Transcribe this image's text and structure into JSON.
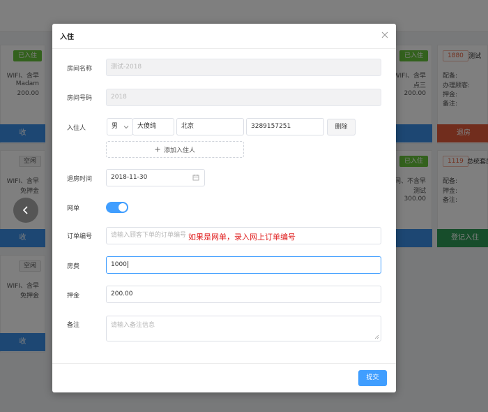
{
  "dialog": {
    "title": "入住",
    "room_name": {
      "label": "房间名称",
      "value": "测试-2018"
    },
    "room_no": {
      "label": "房间号码",
      "value": "2018"
    },
    "guest": {
      "label": "入住人",
      "gender": "男",
      "name": "大傻纯",
      "origin": "北京",
      "phone": "3289157251",
      "delete_label": "删除",
      "add_label": "添加入住人"
    },
    "checkout": {
      "label": "退房时间",
      "value": "2018-11-30"
    },
    "online": {
      "label": "网单",
      "enabled": true
    },
    "order_no": {
      "label": "订单编号",
      "placeholder": "请输入顾客下单的订单编号",
      "annotation": "如果是网单，录入网上订单编号"
    },
    "room_fee": {
      "label": "房费",
      "value": "1000"
    },
    "deposit": {
      "label": "押金",
      "value": "200.00"
    },
    "remark": {
      "label": "备注",
      "placeholder": "请输入备注信息"
    },
    "submit_label": "提交"
  },
  "background": {
    "cards": [
      {
        "tag": "已入住",
        "lines": [
          "WIFI、含早",
          "Madam",
          "200.00"
        ],
        "button": "收"
      },
      {
        "tag": "空闲",
        "lines": [
          "WIFI、含早",
          "免押金"
        ],
        "button": "收"
      },
      {
        "tag": "空闲",
        "lines": [
          "WIFI、含早",
          "免押金"
        ],
        "button": "收"
      },
      {
        "tag": "已入住",
        "lines": [
          "WIFI、含早",
          "点三",
          "200.00"
        ],
        "button": ""
      },
      {
        "tag": "已入住",
        "lines": [
          "同、不含早",
          "测试",
          "300.00"
        ],
        "button": ""
      },
      {
        "tag": "1880",
        "title": "测试",
        "lines": [
          "配备:",
          "办理顾客:",
          "押金:",
          "备注:"
        ],
        "button": "退房"
      },
      {
        "tag": "1119",
        "title": "总统套房",
        "lines": [
          "配备:",
          "押金:",
          "备注:"
        ],
        "button": "登记入住"
      }
    ]
  },
  "icons": {
    "close": "close-icon",
    "calendar": "calendar-icon",
    "chevron": "chevron-down-icon",
    "plus": "plus-icon",
    "back": "chevron-left-icon"
  },
  "colors": {
    "primary": "#409eff",
    "annotation": "#e02020",
    "checked_in": "#67c23a"
  }
}
